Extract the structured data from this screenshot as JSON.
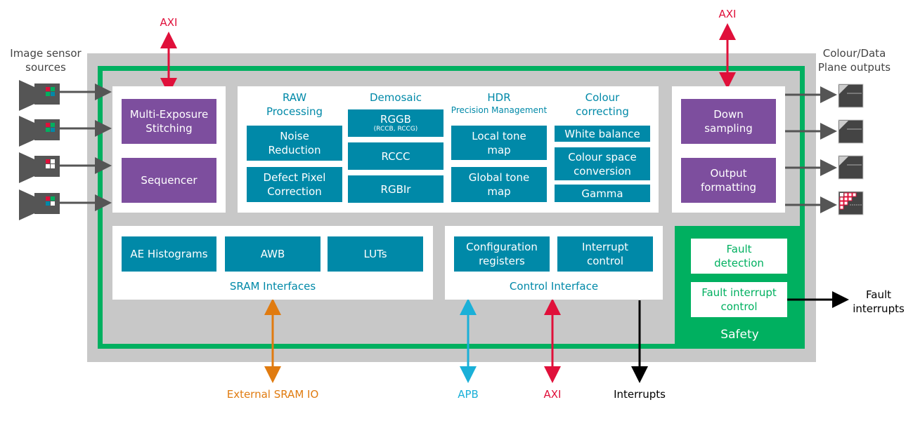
{
  "colors": {
    "gray": "#c8c8c8",
    "green": "#00b060",
    "teal": "#0089a8",
    "purple": "#7d4e9e",
    "axi_red": "#e0103a",
    "sram_orange": "#e07b10",
    "apb_cyan": "#1ab0d8",
    "arrow_gray": "#555555"
  },
  "inputs": {
    "title_line1": "Image sensor",
    "title_line2": "sources",
    "sensors": [
      "RGGB",
      "RGGB",
      "RCCC",
      "RGBIr"
    ],
    "sensor_icon": "camera-icon"
  },
  "outputs": {
    "title_line1": "Colour/Data",
    "title_line2": "Plane outputs",
    "output_icon": "image-plane-icon"
  },
  "top_axi_left": "AXI",
  "top_axi_right": "AXI",
  "input_stage": {
    "multi_exposure": [
      "Multi-Exposure",
      "Stitching"
    ],
    "sequencer": "Sequencer"
  },
  "pipeline": {
    "raw": {
      "heading": [
        "RAW",
        "Processing"
      ],
      "blocks": [
        [
          "Noise",
          "Reduction"
        ],
        [
          "Defect Pixel",
          "Correction"
        ]
      ]
    },
    "demosaic": {
      "heading": "Demosaic",
      "rggb": "RGGB",
      "rggb_sub": "(RCCB, RCCG)",
      "rccc": "RCCC",
      "rgbir": "RGBIr"
    },
    "hdr": {
      "heading": "HDR",
      "subheading": "Precision Management",
      "blocks": [
        [
          "Local tone",
          "map"
        ],
        [
          "Global tone",
          "map"
        ]
      ]
    },
    "colour": {
      "heading": [
        "Colour",
        "correcting"
      ],
      "white_balance": "White balance",
      "colour_space": [
        "Colour space",
        "conversion"
      ],
      "gamma": "Gamma"
    }
  },
  "output_stage": {
    "down_sampling": [
      "Down",
      "sampling"
    ],
    "output_formatting": [
      "Output",
      "formatting"
    ]
  },
  "sram": {
    "blocks": [
      "AE Histograms",
      "AWB",
      "LUTs"
    ],
    "label": "SRAM Interfaces"
  },
  "control": {
    "config": [
      "Configuration",
      "registers"
    ],
    "interrupt": [
      "Interrupt",
      "control"
    ],
    "label": "Control Interface"
  },
  "safety": {
    "fault_detection": [
      "Fault",
      "detection"
    ],
    "fault_interrupt": [
      "Fault interrupt",
      "control"
    ],
    "label": "Safety"
  },
  "bottom": {
    "sram_io": "External SRAM IO",
    "apb": "APB",
    "axi": "AXI",
    "interrupts": "Interrupts"
  },
  "fault_interrupts": [
    "Fault",
    "interrupts"
  ]
}
